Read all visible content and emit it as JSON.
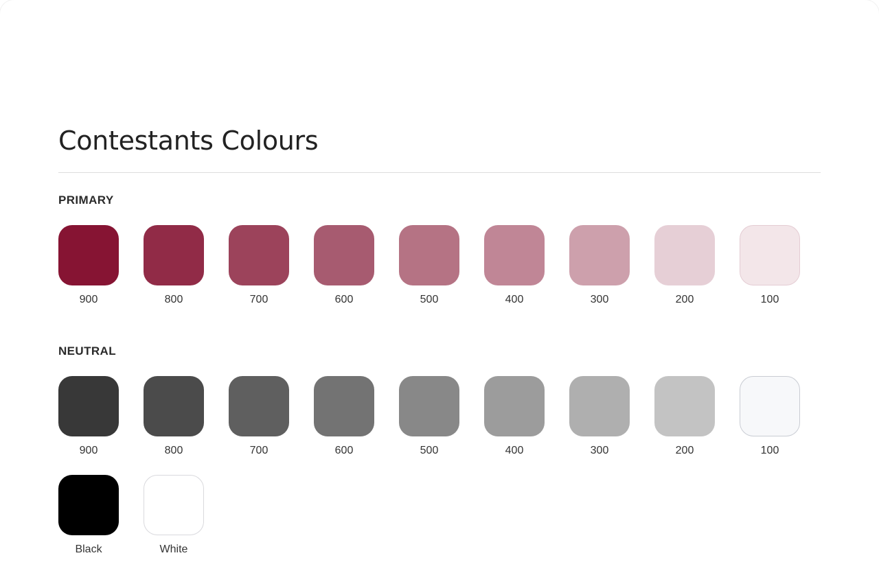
{
  "page": {
    "title": "Contestants Colours"
  },
  "primary": {
    "label": "PRIMARY",
    "swatches": [
      {
        "name": "900",
        "color": "#861433"
      },
      {
        "name": "800",
        "color": "#912b47"
      },
      {
        "name": "700",
        "color": "#9c435b"
      },
      {
        "name": "600",
        "color": "#a75b70"
      },
      {
        "name": "500",
        "color": "#b57384"
      },
      {
        "name": "400",
        "color": "#c08696"
      },
      {
        "name": "300",
        "color": "#cda0ac"
      },
      {
        "name": "200",
        "color": "#e6cfd6"
      },
      {
        "name": "100",
        "color": "#f3e6e9"
      }
    ]
  },
  "neutral": {
    "label": "NEUTRAL",
    "swatches": [
      {
        "name": "900",
        "color": "#383838"
      },
      {
        "name": "800",
        "color": "#4b4b4b"
      },
      {
        "name": "700",
        "color": "#5f5f5f"
      },
      {
        "name": "600",
        "color": "#737373"
      },
      {
        "name": "500",
        "color": "#888888"
      },
      {
        "name": "400",
        "color": "#9c9c9c"
      },
      {
        "name": "300",
        "color": "#afafaf"
      },
      {
        "name": "200",
        "color": "#c3c3c3"
      },
      {
        "name": "100",
        "color": "#f7f8fa"
      }
    ],
    "extra": [
      {
        "name": "Black",
        "color": "#000000"
      },
      {
        "name": "White",
        "color": "#ffffff"
      }
    ]
  }
}
